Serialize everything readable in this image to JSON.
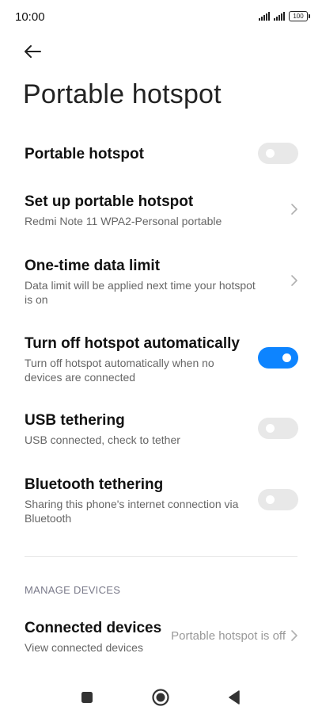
{
  "status_bar": {
    "time": "10:00",
    "battery": "100"
  },
  "page": {
    "title": "Portable hotspot"
  },
  "settings": [
    {
      "title": "Portable hotspot",
      "subtitle": "",
      "control": "toggle",
      "on": false
    },
    {
      "title": "Set up portable hotspot",
      "subtitle": "Redmi Note 11 WPA2-Personal portable",
      "control": "chevron"
    },
    {
      "title": "One-time data limit",
      "subtitle": "Data limit will be applied next time your hotspot is on",
      "control": "chevron"
    },
    {
      "title": "Turn off hotspot automatically",
      "subtitle": "Turn off hotspot automatically when no devices are connected",
      "control": "toggle",
      "on": true
    },
    {
      "title": "USB tethering",
      "subtitle": "USB connected, check to tether",
      "control": "toggle",
      "on": false
    },
    {
      "title": "Bluetooth tethering",
      "subtitle": "Sharing this phone's internet connection via Bluetooth",
      "control": "toggle",
      "on": false
    }
  ],
  "manage_section": {
    "header": "MANAGE DEVICES",
    "connected": {
      "title": "Connected devices",
      "subtitle": "View connected devices",
      "value": "Portable hotspot is off"
    }
  },
  "colors": {
    "accent": "#0d84ff",
    "toggle_off": "#e8e8e8",
    "subtitle": "#666666",
    "section_header": "#7a7a8a"
  },
  "icons": {
    "back": "arrow-left-icon",
    "chevron": "chevron-right-icon",
    "nav_recents": "square-icon",
    "nav_home": "circle-icon",
    "nav_back": "triangle-back-icon"
  }
}
